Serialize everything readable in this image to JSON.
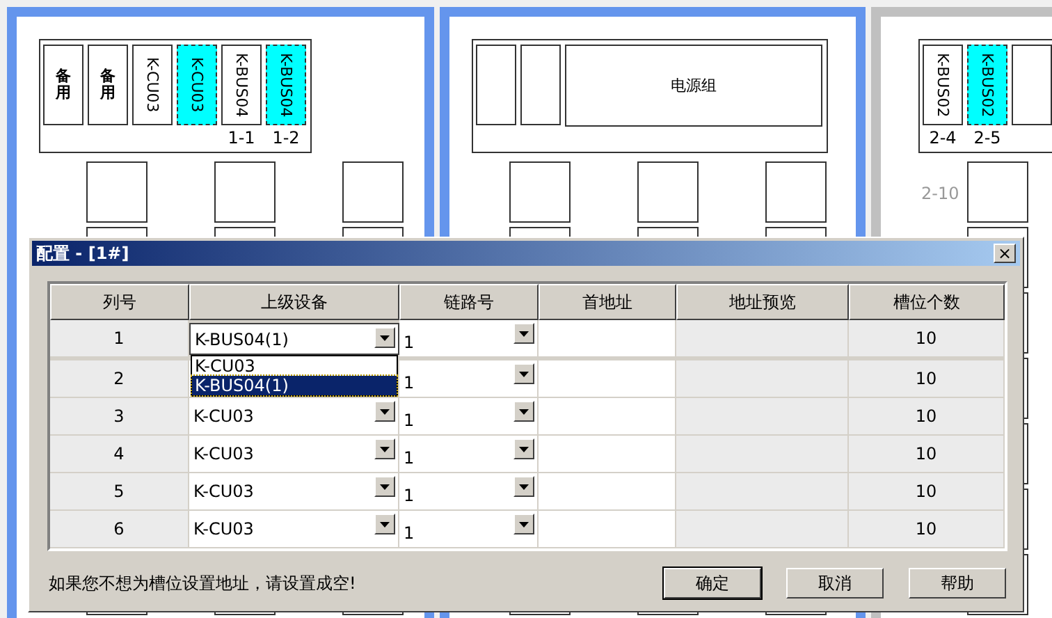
{
  "canvas": {
    "panels": [
      {
        "color": "#6495ed",
        "slots": [
          {
            "kind": "stacked",
            "label": "备用",
            "highlighted": false
          },
          {
            "kind": "stacked",
            "label": "备用",
            "highlighted": false
          },
          {
            "kind": "rotated",
            "label": "K-CU03",
            "highlighted": false
          },
          {
            "kind": "rotated",
            "label": "K-CU03",
            "highlighted": true
          },
          {
            "kind": "rotated",
            "label": "K-BUS04",
            "highlighted": false,
            "address": "1-1"
          },
          {
            "kind": "rotated",
            "label": "K-BUS04",
            "highlighted": true,
            "address": "1-2"
          }
        ]
      },
      {
        "color": "#6495ed",
        "slots": [
          {
            "kind": "rotated",
            "highlighted": false
          },
          {
            "kind": "rotated",
            "highlighted": false
          },
          {
            "kind": "wide",
            "label": "电源组",
            "highlighted": false
          }
        ]
      },
      {
        "color": "#c0c0c0",
        "side_label": "2-10",
        "slots": [
          {
            "kind": "rotated",
            "label": "K-BUS02",
            "highlighted": false,
            "address": "2-4"
          },
          {
            "kind": "rotated",
            "label": "K-BUS02",
            "highlighted": true,
            "address": "2-5"
          },
          {
            "kind": "rotated",
            "highlighted": false
          }
        ]
      }
    ]
  },
  "dialog": {
    "title": "配置 - [1#]",
    "close": "×",
    "table": {
      "columns": [
        "列号",
        "上级设备",
        "链路号",
        "首地址",
        "地址预览",
        "槽位个数"
      ],
      "rows": [
        {
          "number": "1",
          "device": "K-BUS04(1)",
          "link": "1",
          "slot_count": "10",
          "options": [
            {
              "label": "K-CU03",
              "selected": false
            },
            {
              "label": "K-BUS04(1)",
              "selected": true
            }
          ]
        },
        {
          "number": "2",
          "device": "",
          "link": "1",
          "slot_count": "10"
        },
        {
          "number": "3",
          "device": "K-CU03",
          "link": "1",
          "slot_count": "10"
        },
        {
          "number": "4",
          "device": "K-CU03",
          "link": "1",
          "slot_count": "10"
        },
        {
          "number": "5",
          "device": "K-CU03",
          "link": "1",
          "slot_count": "10"
        },
        {
          "number": "6",
          "device": "K-CU03",
          "link": "1",
          "slot_count": "10"
        }
      ]
    },
    "hint": "如果您不想为槽位设置地址，请设置成空!",
    "buttons": [
      {
        "label": "确定",
        "default": true
      },
      {
        "label": "取消",
        "default": false
      },
      {
        "label": "帮助",
        "default": false
      }
    ]
  }
}
